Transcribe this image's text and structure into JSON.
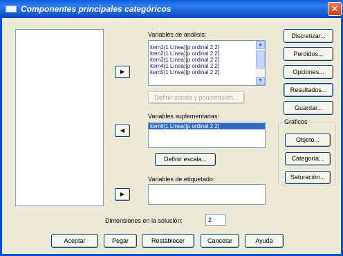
{
  "window": {
    "title": "Componentes principales categóricos",
    "close": "✕"
  },
  "variables_analisis": {
    "label": "Variables de análisis:",
    "items": [
      "item1(1 Línea)[p ordinal 2 2]",
      "item2(1 Línea)[p ordinal 2 2]",
      "item3(1 Línea)[p ordinal 2 2]",
      "item4(1 Línea)[p ordinal 2 2]",
      "item5(1 Línea)[p ordinal 2 2]"
    ],
    "define_button": "Definir escala y ponderación..."
  },
  "variables_suplementarias": {
    "label": "Variables suplementarias:",
    "items": [
      "item6(1 Línea)[p ordinal 2 2]"
    ],
    "define_button": "Definir escala..."
  },
  "variables_etiquetado": {
    "label": "Variables de etiquetado:"
  },
  "dimensiones": {
    "label": "Dimensiones en la solución:",
    "value": "2"
  },
  "right_buttons": [
    "Discretizar...",
    "Perdidos...",
    "Opciones...",
    "Resultados...",
    "Guardar..."
  ],
  "graficos": {
    "legend": "Gráficos",
    "buttons": [
      "Objeto...",
      "Categoría...",
      "Saturación..."
    ]
  },
  "bottom_buttons": [
    "Aceptar",
    "Pegar",
    "Restablecer",
    "Cancelar",
    "Ayuda"
  ],
  "arrows": {
    "right": "▶",
    "left": "◀"
  }
}
